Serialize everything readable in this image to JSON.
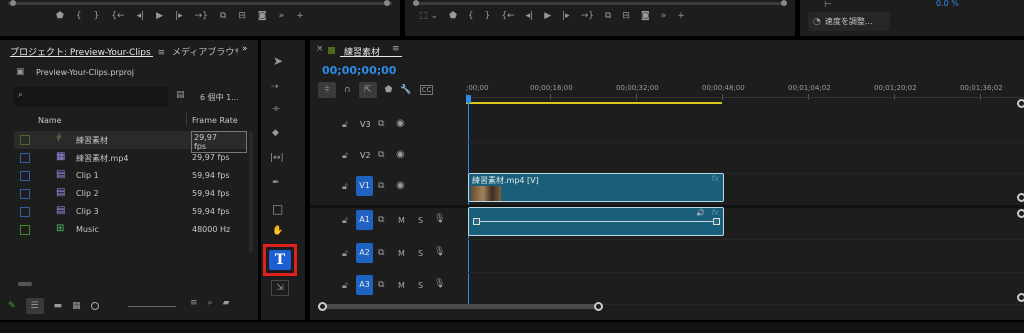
{
  "top_monitor_left": {
    "controls": [
      "marker-icon",
      "in-brace-icon",
      "out-brace-icon",
      "go-in-icon",
      "step-back-icon",
      "play-icon",
      "step-forward-icon",
      "go-out-icon",
      "insert-icon",
      "overwrite-icon",
      "export-frame-icon",
      "more-icon",
      "add-icon"
    ]
  },
  "top_monitor_right": {
    "controls": [
      "safe-margins-icon",
      "chevron-icon",
      "marker-icon",
      "in-brace-icon",
      "out-brace-icon",
      "go-in-icon",
      "step-back-icon",
      "play-icon",
      "step-forward-icon",
      "go-out-icon",
      "lift-icon",
      "extract-icon",
      "export-frame-icon",
      "more-icon",
      "add-icon"
    ]
  },
  "right_panel": {
    "percent": "0.0 %",
    "speed_button": "速度を調整..."
  },
  "project": {
    "tab_label": "プロジェクト: Preview-Your-Clips",
    "tab2_label": "メディアブラウザ",
    "file_name": "Preview-Your-Clips.prproj",
    "search_placeholder": "",
    "item_count": "6 個中 1...",
    "col_name": "Name",
    "col_framerate": "Frame Rate",
    "items": [
      {
        "name": "練習素材",
        "rate": "29,97 fps",
        "color": "#4a6a21",
        "icon": "sequence-icon"
      },
      {
        "name": "練習素材.mp4",
        "rate": "29,97 fps",
        "color": "#2b5f9e",
        "icon": "video-clip-icon"
      },
      {
        "name": "Clip 1",
        "rate": "59,94 fps",
        "color": "#2b5f9e",
        "icon": "clip-icon"
      },
      {
        "name": "Clip 2",
        "rate": "59,94 fps",
        "color": "#2b5f9e",
        "icon": "clip-icon"
      },
      {
        "name": "Clip 3",
        "rate": "59,94 fps",
        "color": "#2b5f9e",
        "icon": "clip-icon"
      },
      {
        "name": "Music",
        "rate": "48000 Hz",
        "color": "#3c8a2e",
        "icon": "audio-icon"
      }
    ]
  },
  "timeline": {
    "tab_label": "練習素材",
    "timecode": "00;00;00;00",
    "ruler": [
      ";00;00",
      "00;00;16;00",
      "00;00;32;00",
      "00;00;48;00",
      "00;01;04;02",
      "00;01;20;02",
      "00;01;36;02"
    ],
    "video_tracks": [
      "V3",
      "V2",
      "V1"
    ],
    "audio_tracks": [
      "A1",
      "A2",
      "A3"
    ],
    "m_label": "M",
    "s_label": "S",
    "clip_label": "練習素材.mp4 [V]",
    "fx_label": "fx"
  },
  "colors": {
    "accent_blue": "#2d8ceb",
    "track_blue": "#1f63c2",
    "clip_teal": "#1a5f7a",
    "highlight_red": "#e0201e"
  }
}
